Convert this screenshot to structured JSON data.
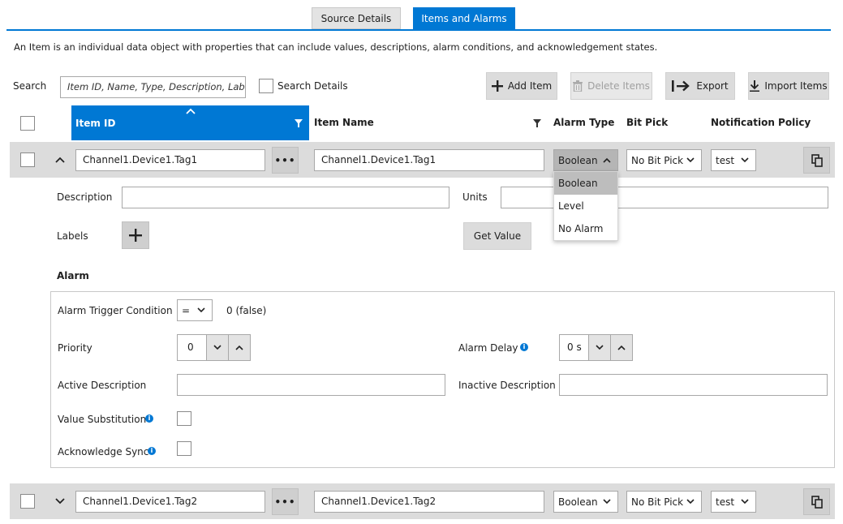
{
  "tabs": [
    {
      "label": "Source Details",
      "active": false
    },
    {
      "label": "Items and Alarms",
      "active": true
    }
  ],
  "colors": {
    "accent": "#0078d4",
    "row_bg": "#dcdcdc",
    "button_bg": "#dcdcdc"
  },
  "intro_text": "An Item is an individual data object with properties that can include values, descriptions, alarm conditions, and acknowledgement states.",
  "search": {
    "label": "Search",
    "placeholder": "Item ID, Name, Type, Description, Labels",
    "details_label": "Search Details"
  },
  "toolbar": {
    "add_label": "Add Item",
    "delete_label": "Delete Items",
    "export_label": "Export",
    "import_label": "Import Items"
  },
  "columns": {
    "item_id": "Item ID",
    "item_name": "Item Name",
    "alarm_type": "Alarm Type",
    "bit_pick": "Bit Pick",
    "notification_policy": "Notification Policy"
  },
  "rows": [
    {
      "item_id": "Channel1.Device1.Tag1",
      "item_name": "Channel1.Device1.Tag1",
      "alarm_type": "Boolean",
      "bit_pick": "No Bit Pick",
      "policy": "test",
      "expanded": true
    },
    {
      "item_id": "Channel1.Device1.Tag2",
      "item_name": "Channel1.Device1.Tag2",
      "alarm_type": "Boolean",
      "bit_pick": "No Bit Pick",
      "policy": "test",
      "expanded": false
    }
  ],
  "alarm_type_options": [
    "Boolean",
    "Level",
    "No Alarm"
  ],
  "details": {
    "description_label": "Description",
    "description_value": "",
    "units_label": "Units",
    "units_value": "",
    "labels_label": "Labels",
    "get_value_label": "Get Value"
  },
  "alarm": {
    "section_title": "Alarm",
    "trigger_label": "Alarm Trigger Condition",
    "trigger_operator": "=",
    "trigger_value": "0 (false)",
    "priority_label": "Priority",
    "priority_value": "0",
    "delay_label": "Alarm Delay",
    "delay_value": "0 s",
    "active_desc_label": "Active Description",
    "active_desc_value": "",
    "inactive_desc_label": "Inactive Description",
    "inactive_desc_value": "",
    "value_sub_label": "Value Substitution",
    "ack_sync_label": "Acknowledge Sync"
  }
}
